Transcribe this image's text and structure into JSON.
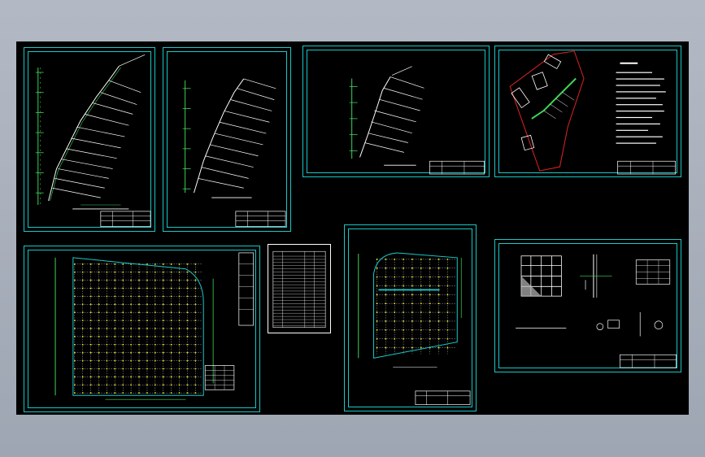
{
  "colors": {
    "background": "#a7aebb",
    "canvas": "#000000",
    "frame": "#19c8c8",
    "linework": "#ffffff",
    "dimension": "#3dd65a",
    "grid_points": "#e6e62a",
    "boundary": "#e02424",
    "hatch": "#b8b8b8"
  },
  "icons": {
    "frame": "drawing-frame",
    "title_block": "title-block-table",
    "north_arrow": "north-arrow-icon"
  },
  "sheets": [
    {
      "id": "section-1",
      "type": "slope-section"
    },
    {
      "id": "section-2",
      "type": "slope-section"
    },
    {
      "id": "section-3",
      "type": "slope-section"
    },
    {
      "id": "site-plan",
      "type": "plan-with-notes"
    },
    {
      "id": "grid-plan-large",
      "type": "grid-plan"
    },
    {
      "id": "material-table",
      "type": "table"
    },
    {
      "id": "grid-plan-small",
      "type": "grid-plan"
    },
    {
      "id": "details",
      "type": "detail-drawings"
    }
  ]
}
